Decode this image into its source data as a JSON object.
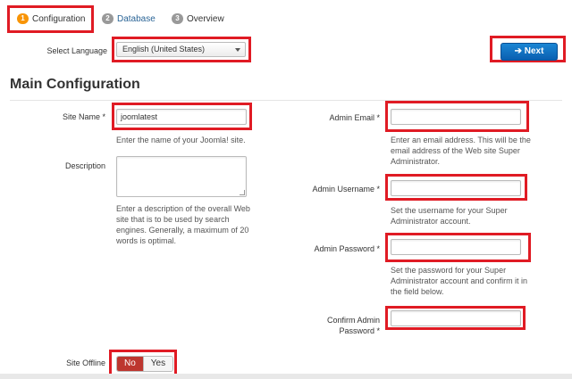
{
  "tabs": [
    {
      "number": "1",
      "label": "Configuration"
    },
    {
      "number": "2",
      "label": "Database"
    },
    {
      "number": "3",
      "label": "Overview"
    }
  ],
  "language": {
    "label": "Select Language",
    "value": "English (United States)"
  },
  "next_button": {
    "icon": "arrow-right-icon",
    "label": "Next"
  },
  "heading": "Main Configuration",
  "site_name": {
    "label": "Site Name *",
    "value": "joomlatest",
    "help": "Enter the name of your Joomla! site."
  },
  "description": {
    "label": "Description",
    "value": "",
    "help_lines": [
      "Enter a description of the overall Web",
      "site that is to be used by search",
      "engines. Generally, a maximum of 20",
      "words is optimal."
    ]
  },
  "admin_email": {
    "label": "Admin Email *",
    "value": "",
    "help_lines": [
      "Enter an email address. This will be the",
      "email address of the Web site Super",
      "Administrator."
    ]
  },
  "admin_username": {
    "label": "Admin Username *",
    "value": "",
    "help_lines": [
      "Set the username for your Super",
      "Administrator account."
    ]
  },
  "admin_password": {
    "label": "Admin Password *",
    "value": "",
    "help_lines": [
      "Set the password for your Super",
      "Administrator account and confirm it in",
      "the field below."
    ]
  },
  "confirm_password": {
    "label_lines": [
      "Confirm Admin",
      "Password *"
    ],
    "value": ""
  },
  "site_offline": {
    "label": "Site Offline",
    "options": [
      "No",
      "Yes"
    ],
    "selected": "No"
  },
  "colors": {
    "highlight": "#e01b24",
    "primary": "#0a5fb0",
    "danger": "#bd362f",
    "step_active": "#f89406"
  }
}
